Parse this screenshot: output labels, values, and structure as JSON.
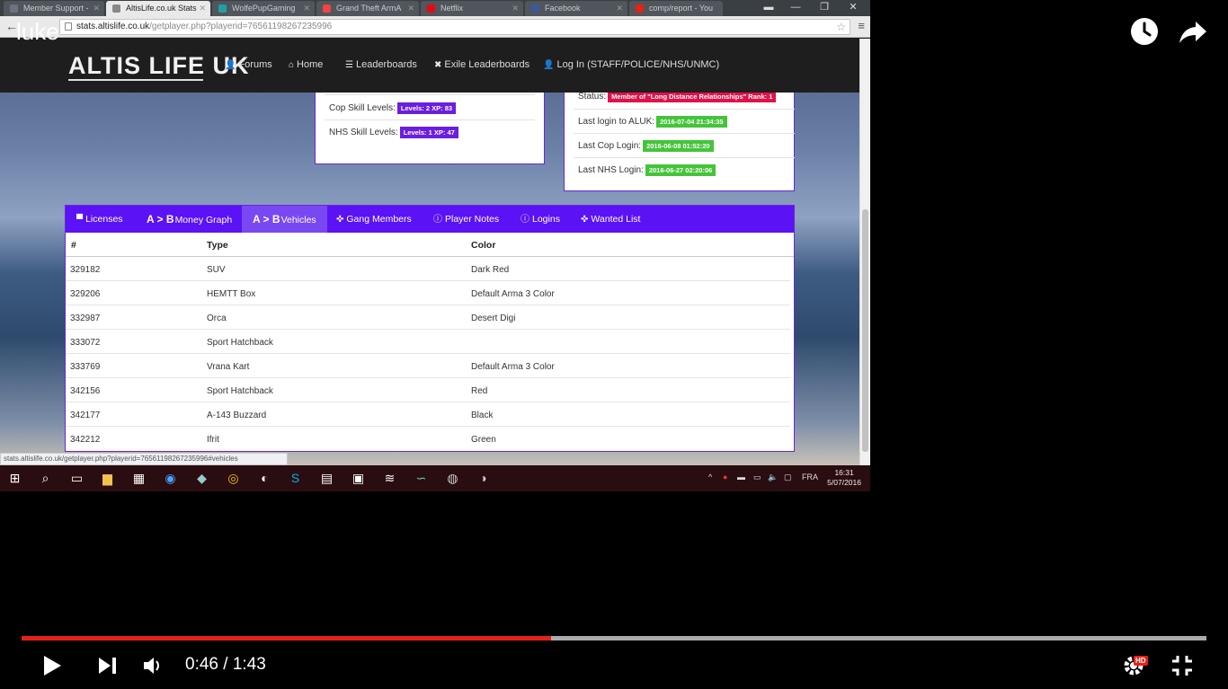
{
  "video": {
    "title": "luke",
    "current_time": "0:46",
    "separator": " / ",
    "duration": "1:43",
    "progress_percent": 44.7,
    "hd_label": "HD"
  },
  "browser": {
    "tabs": [
      {
        "title": "Member Support - ",
        "icon_color": "#6b7280"
      },
      {
        "title": "AltisLife.co.uk Stats",
        "icon_color": "#888",
        "active": true
      },
      {
        "title": "WolfePupGaming",
        "icon_color": "#21a0a0"
      },
      {
        "title": "Grand Theft ArmA",
        "icon_color": "#e44"
      },
      {
        "title": "Netflix",
        "icon_color": "#e50914"
      },
      {
        "title": "Facebook",
        "icon_color": "#3b5998"
      },
      {
        "title": "comp/report - You",
        "icon_color": "#e62117"
      }
    ],
    "url_host": "stats.altislife.co.uk",
    "url_path": "/getplayer.php?playerid=76561198267235996",
    "status_url": "stats.altislife.co.uk/getplayer.php?playerid=76561198267235996#vehicles"
  },
  "site": {
    "logo": "ALTIS LIFE UK",
    "nav": [
      "Forums",
      "Home",
      "Leaderboards",
      "Exile Leaderboards",
      "Log In (STAFF/POLICE/NHS/UNMC)"
    ]
  },
  "skills": {
    "cop_label": "Cop Skill Levels:",
    "cop_value": "Levels: 2 XP: 83",
    "nhs_label": "NHS Skill Levels:",
    "nhs_value": "Levels: 1 XP: 47"
  },
  "status_card": {
    "status_label": "Status:",
    "status_value": "Member of \"Long Distance Relationships\" Rank: 1",
    "last_login_label": "Last login to ALUK:",
    "last_login_value": "2016-07-04 21:34:35",
    "last_cop_label": "Last Cop Login:",
    "last_cop_value": "2016-06-08 01:52:20",
    "last_nhs_label": "Last NHS Login:",
    "last_nhs_value": "2016-06-27 02:20:06"
  },
  "panel": {
    "tabs": [
      {
        "label": "Licenses",
        "icon": "id-card-icon"
      },
      {
        "prefix": "A > B",
        "label": "Money Graph",
        "icon": "ab-icon"
      },
      {
        "prefix": "A > B",
        "label": "Vehicles",
        "icon": "ab-icon",
        "active": true
      },
      {
        "label": "Gang Members",
        "icon": "crosshair-icon"
      },
      {
        "label": "Player Notes",
        "icon": "info-icon"
      },
      {
        "label": "Logins",
        "icon": "info-icon"
      },
      {
        "label": "Wanted List",
        "icon": "crosshair-icon"
      }
    ],
    "headers": [
      "#",
      "Type",
      "Color"
    ],
    "rows": [
      [
        "329182",
        "SUV",
        "Dark Red"
      ],
      [
        "329206",
        "HEMTT Box",
        "Default Arma 3 Color"
      ],
      [
        "332987",
        "Orca",
        "Desert Digi"
      ],
      [
        "333072",
        "Sport Hatchback",
        ""
      ],
      [
        "333769",
        "Vrana Kart",
        "Default Arma 3 Color"
      ],
      [
        "342156",
        "Sport Hatchback",
        "Red"
      ],
      [
        "342177",
        "A-143 Buzzard",
        "Black"
      ],
      [
        "342212",
        "Ifrit",
        "Green"
      ]
    ]
  },
  "taskbar": {
    "language": "FRA",
    "time": "16:31",
    "date": "5/07/2016"
  }
}
